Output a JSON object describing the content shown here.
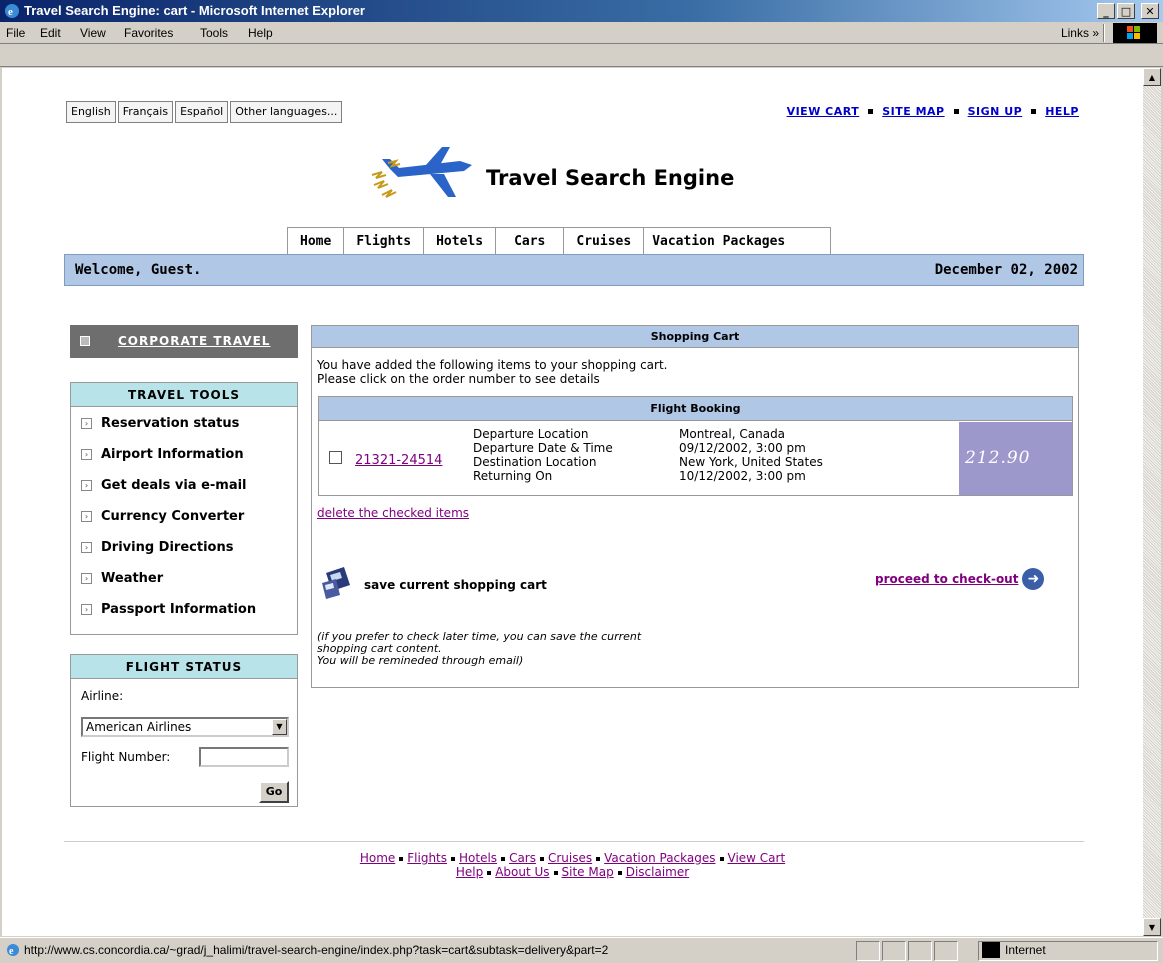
{
  "window": {
    "title": "Travel Search Engine: cart - Microsoft Internet Explorer",
    "min_label": "_",
    "max_label": "□",
    "close_label": "✕"
  },
  "menu": {
    "file": "File",
    "edit": "Edit",
    "view": "View",
    "favorites": "Favorites",
    "tools": "Tools",
    "help": "Help",
    "links": "Links »"
  },
  "languages": [
    "English",
    "Français",
    "Español",
    "Other languages..."
  ],
  "top_links": {
    "view_cart": "VIEW CART",
    "site_map": "SITE MAP",
    "sign_up": "SIGN UP",
    "help": "HELP"
  },
  "brand": "Travel Search Engine",
  "nav_tabs": [
    "Home",
    "Flights",
    "Hotels",
    "Cars",
    "Cruises",
    "Vacation Packages"
  ],
  "welcome": {
    "greeting": "Welcome, Guest.",
    "date": "December 02, 2002"
  },
  "corporate": "CORPORATE TRAVEL",
  "travel_tools": {
    "heading": "TRAVEL TOOLS",
    "items": [
      "Reservation status",
      "Airport Information",
      "Get deals via e-mail",
      "Currency Converter",
      "Driving Directions",
      "Weather",
      "Passport Information"
    ]
  },
  "flight_status": {
    "heading": "FLIGHT STATUS",
    "airline_label": "Airline:",
    "airline_value": "American Airlines",
    "flight_number_label": "Flight Number:",
    "go_label": "Go"
  },
  "cart": {
    "heading": "Shopping Cart",
    "intro_1": "You have added the following items to your shopping cart.",
    "intro_2": "Please click on the order number to see details",
    "booking_heading": "Flight Booking",
    "order_number": "21321-24514",
    "labels": [
      "Departure Location",
      "Departure Date & Time",
      "Destination Location",
      "Returning On"
    ],
    "values": [
      "Montreal, Canada",
      "09/12/2002, 3:00 pm",
      "New York, United States",
      "10/12/2002, 3:00 pm"
    ],
    "price": "212.90",
    "delete_link": "delete the checked items",
    "save_label": "save current shopping cart",
    "checkout_link": "proceed to check-out",
    "note_1": "(if you prefer to check later time, you can save the current",
    "note_2": "shopping cart content.",
    "note_3": "You will be remineded through email)"
  },
  "footer": {
    "row1": [
      "Home",
      "Flights",
      "Hotels",
      "Cars",
      "Cruises",
      "Vacation Packages",
      "View Cart"
    ],
    "row2": [
      "Help",
      "About Us",
      "Site Map",
      "Disclaimer"
    ]
  },
  "status": {
    "url": "http://www.cs.concordia.ca/~grad/j_halimi/travel-search-engine/index.php?task=cart&subtask=delivery&part=2",
    "zone": "Internet"
  },
  "colors": {
    "accent": "#b0c8e6",
    "price_bg": "#9c98cc",
    "tools_head": "#b8e3e8"
  }
}
